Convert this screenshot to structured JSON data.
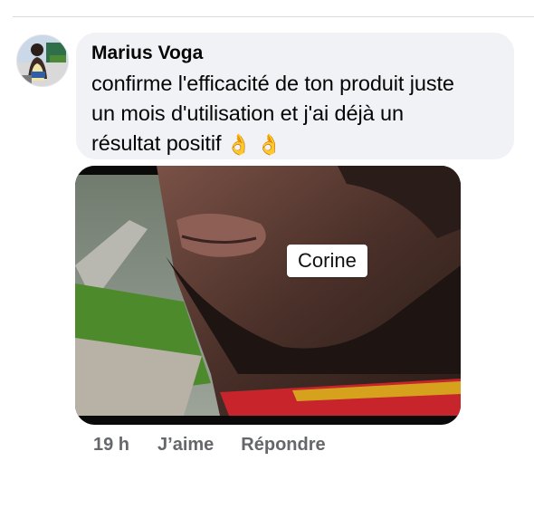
{
  "comment": {
    "author": "Marius Voga",
    "text_lines": [
      "confirme l'efficacité de ton produit juste",
      "un mois d'utilisation et j'ai déjà un",
      "résultat positif"
    ],
    "emojis": [
      "👌",
      "👌"
    ]
  },
  "photo": {
    "tag_label": "Corine"
  },
  "actions": {
    "timestamp": "19 h",
    "like_label": "J’aime",
    "reply_label": "Répondre"
  },
  "colors": {
    "bubble_bg": "#f0f2f5",
    "text": "#050505",
    "secondary_text": "#65676b"
  }
}
